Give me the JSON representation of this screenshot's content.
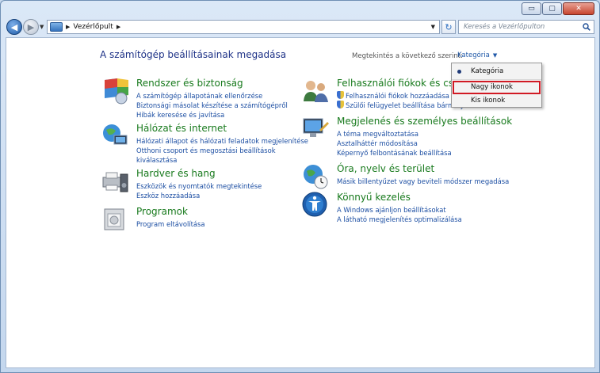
{
  "window": {
    "caption": {
      "minimize": "▭",
      "maximize": "▢",
      "close": "✕"
    }
  },
  "toolbar": {
    "back_glyph": "◀",
    "forward_glyph": "▶",
    "address_crumb": "Vezérlőpult",
    "search_placeholder": "Keresés a Vezérlőpulton"
  },
  "header": {
    "title": "A számítógép beállításainak megadása",
    "view_by_label": "Megtekintés a következő szerint:",
    "view_by_value": "Kategória"
  },
  "view_menu": {
    "items": [
      {
        "label": "Kategória",
        "selected": true
      },
      {
        "label": "Nagy ikonok",
        "highlighted": true
      },
      {
        "label": "Kis ikonok"
      }
    ]
  },
  "categories_left": [
    {
      "title": "Rendszer és biztonság",
      "icon": "shield-computer-icon",
      "links": [
        "A számítógép állapotának ellenőrzése",
        "Biztonsági másolat készítése a számítógépről",
        "Hibák keresése és javítása"
      ]
    },
    {
      "title": "Hálózat és internet",
      "icon": "network-globe-icon",
      "links": [
        "Hálózati állapot és hálózati feladatok megjelenítése",
        "Otthoni csoport és megosztási beállítások",
        "kiválasztása"
      ]
    },
    {
      "title": "Hardver és hang",
      "icon": "printer-speaker-icon",
      "links": [
        "Eszközök és nyomtatók megtekintése",
        "Eszköz hozzáadása"
      ]
    },
    {
      "title": "Programok",
      "icon": "programs-icon",
      "links": [
        "Program eltávolítása"
      ]
    }
  ],
  "categories_right": [
    {
      "title": "Felhasználói fiókok és család",
      "icon": "users-icon",
      "links": [
        "Felhasználói fiókok hozzáadása vagy",
        "Szülői felügyelet beállítása bármely"
      ]
    },
    {
      "title": "Megjelenés és személyes beállítások",
      "icon": "monitor-paint-icon",
      "links": [
        "A téma megváltoztatása",
        "Asztalháttér módosítása",
        "Képernyő felbontásának beállítása"
      ]
    },
    {
      "title": "Óra, nyelv és terület",
      "icon": "clock-globe-icon",
      "links": [
        "Másik billentyűzet vagy beviteli módszer megadása"
      ]
    },
    {
      "title": "Könnyű kezelés",
      "icon": "ease-of-access-icon",
      "links": [
        "A Windows ajánljon beállításokat",
        "A látható megjelenítés optimalizálása"
      ]
    }
  ]
}
